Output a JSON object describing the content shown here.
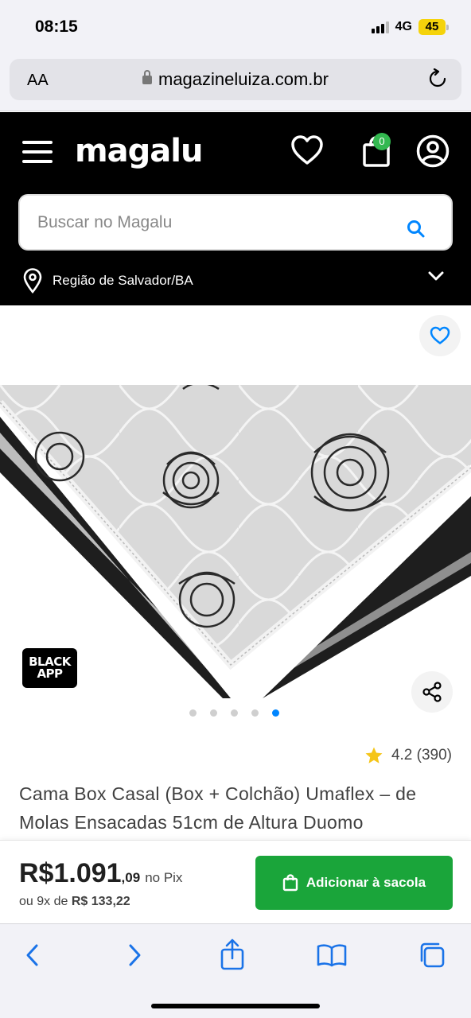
{
  "status_bar": {
    "time": "08:15",
    "network": "4G",
    "battery": "45"
  },
  "browser": {
    "aa_label": "AA",
    "domain": "magazineluiza.com.br"
  },
  "header": {
    "logo": "magalu",
    "cart_count": "0",
    "search_placeholder": "Buscar no Magalu",
    "region": "Região de Salvador/BA"
  },
  "product": {
    "badge_line1": "BLACK",
    "badge_line2": "APP",
    "image_count": 5,
    "active_image": 5,
    "rating": "4.2",
    "reviews": "(390)",
    "title": "Cama Box Casal (Box + Colchão) Umaflex – de Molas Ensacadas 51cm de Altura Duomo"
  },
  "price": {
    "integer": "R$1.091",
    "cents": ",09",
    "pix_label": "no Pix",
    "installments_prefix": "ou 9x de",
    "installments_value": "R$ 133,22",
    "add_button": "Adicionar à sacola"
  },
  "colors": {
    "header_bg": "#000000",
    "accent_blue": "#0086ff",
    "cta_green": "#1aa53a",
    "badge_green": "#33b850",
    "star": "#f5c518"
  },
  "icons": [
    "menu-icon",
    "heart-icon",
    "bag-icon",
    "user-icon",
    "search-icon",
    "location-pin-icon",
    "chevron-down-icon",
    "share-icon",
    "star-icon",
    "back-icon",
    "forward-icon",
    "share-up-icon",
    "bookmarks-icon",
    "tabs-icon"
  ]
}
